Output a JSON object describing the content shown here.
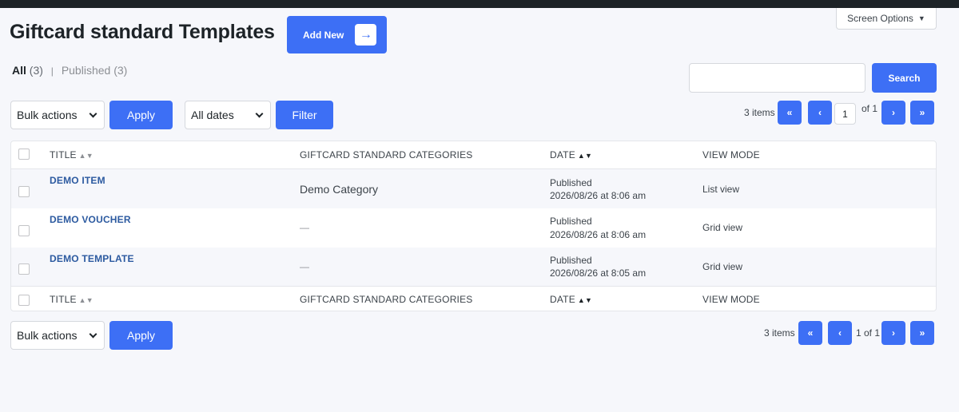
{
  "screen_options": {
    "label": "Screen Options"
  },
  "page": {
    "title": "Giftcard standard Templates",
    "add_new": "Add New"
  },
  "views": {
    "all_label": "All",
    "all_count": "(3)",
    "separator": "|",
    "published_label": "Published",
    "published_count": "(3)"
  },
  "search": {
    "button": "Search",
    "value": ""
  },
  "toolbar_top": {
    "bulk_actions": "Bulk actions",
    "apply": "Apply",
    "dates": "All dates",
    "filter": "Filter",
    "items": "3 items",
    "first": "«",
    "prev": "‹",
    "current_page": "1",
    "of": "of 1",
    "next": "›",
    "last": "»"
  },
  "table": {
    "columns": {
      "title": "Title",
      "categories": "Giftcard standard categories",
      "date": "Date",
      "view_mode": "View mode"
    },
    "rows": [
      {
        "title": "DEMO ITEM",
        "category": "Demo Category",
        "status": "Published",
        "date": "2026/08/26 at 8:06 am",
        "view_mode": "List view"
      },
      {
        "title": "DEMO VOUCHER",
        "category": "—",
        "status": "Published",
        "date": "2026/08/26 at 8:06 am",
        "view_mode": "Grid view"
      },
      {
        "title": "DEMO TEMPLATE",
        "category": "—",
        "status": "Published",
        "date": "2026/08/26 at 8:05 am",
        "view_mode": "Grid view"
      }
    ]
  },
  "toolbar_bottom": {
    "bulk_actions": "Bulk actions",
    "apply": "Apply",
    "items": "3 items",
    "first": "«",
    "prev": "‹",
    "page_of": "1 of 1",
    "next": "›",
    "last": "»"
  },
  "icons": {
    "add_new": "arrow-right-icon",
    "screen_options": "caret-down-icon",
    "sort": "sort-icon",
    "select": "chevron-down-icon"
  },
  "colors": {
    "accent": "#3d6ff5",
    "link": "#2c5aa0",
    "background": "#f6f7fb"
  }
}
